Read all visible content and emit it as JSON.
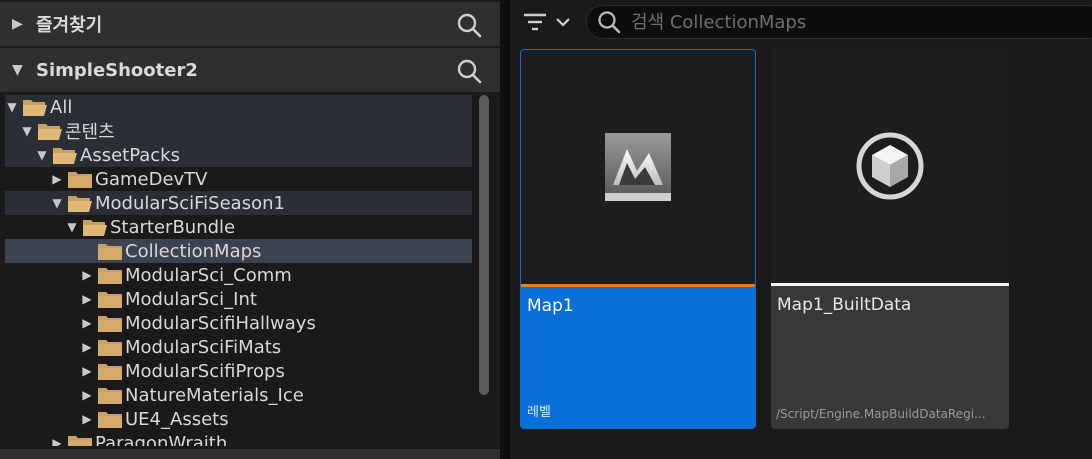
{
  "favorites": {
    "title": "즐겨찾기",
    "arrow_icon": "caret-right-icon",
    "search_icon": "search-icon"
  },
  "project": {
    "title": "SimpleShooter2",
    "arrow_icon": "caret-down-icon",
    "search_icon": "search-icon"
  },
  "tree": {
    "items": [
      {
        "label": "All",
        "expanded": true
      },
      {
        "label": "콘텐츠",
        "expanded": true
      },
      {
        "label": "AssetPacks",
        "expanded": true
      },
      {
        "label": "GameDevTV",
        "expanded": false
      },
      {
        "label": "ModularSciFiSeason1",
        "expanded": true
      },
      {
        "label": "StarterBundle",
        "expanded": true
      },
      {
        "label": "CollectionMaps",
        "expanded": false,
        "selected": true
      },
      {
        "label": "ModularSci_Comm",
        "expanded": false
      },
      {
        "label": "ModularSci_Int",
        "expanded": false
      },
      {
        "label": "ModularScifiHallways",
        "expanded": false
      },
      {
        "label": "ModularSciFiMats",
        "expanded": false
      },
      {
        "label": "ModularScifiProps",
        "expanded": false
      },
      {
        "label": "NatureMaterials_Ice",
        "expanded": false
      },
      {
        "label": "UE4_Assets",
        "expanded": false
      },
      {
        "label": "ParagonWraith",
        "expanded": false
      }
    ]
  },
  "toolbar": {
    "filter_icon": "filter-icon",
    "search_placeholder": "검색 CollectionMaps"
  },
  "assets": [
    {
      "name": "Map1",
      "type": "레벨",
      "icon": "level-map-icon",
      "accent": "#e0801f",
      "selected": true
    },
    {
      "name": "Map1_BuiltData",
      "path": "/Script/Engine.MapBuildDataRegi...",
      "icon": "data-asset-icon",
      "accent": "#f2f2f2",
      "selected": false
    }
  ],
  "colors": {
    "selection_blue": "#0a6fd6",
    "folder": "#c9a064",
    "row_selected": "#3b4350"
  }
}
